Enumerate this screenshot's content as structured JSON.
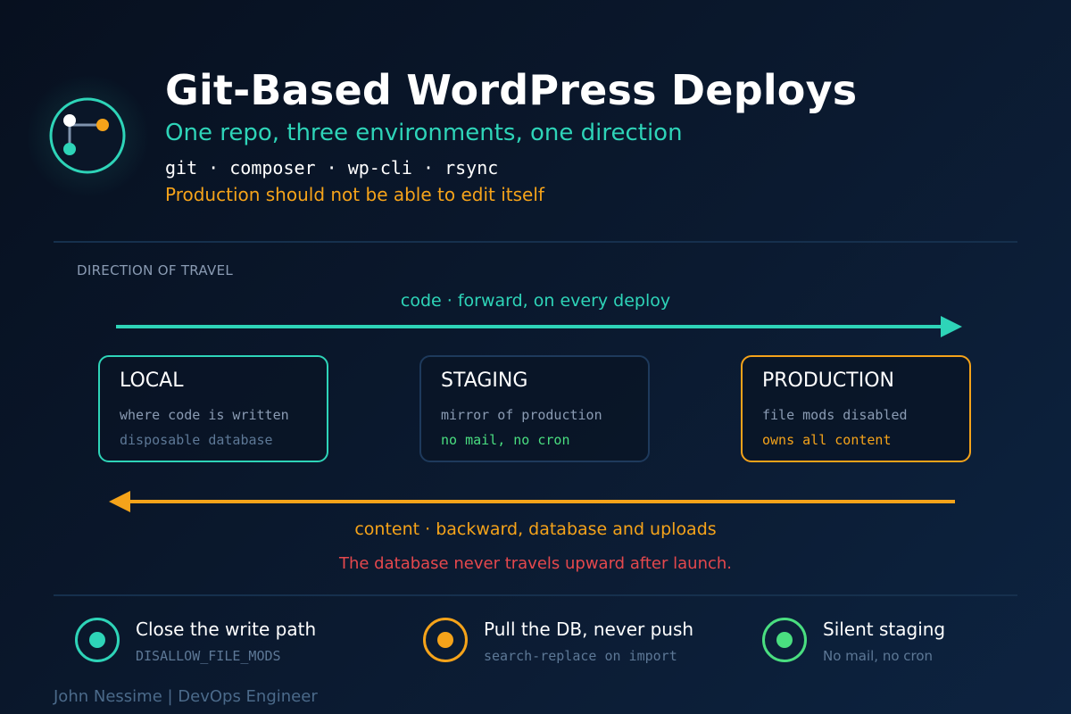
{
  "header": {
    "title": "Git-Based WordPress Deploys",
    "subtitle": "One repo, three environments, one direction",
    "tools": "git · composer · wp-cli · rsync",
    "warning": "Production should not be able to edit itself"
  },
  "flow": {
    "section_label": "DIRECTION OF TRAVEL",
    "code_caption": "code · forward, on every deploy",
    "content_caption": "content · backward, database and uploads",
    "db_warning": "The database never travels upward after launch."
  },
  "environments": [
    {
      "name": "LOCAL",
      "line1": "where code is written",
      "line2": "disposable database"
    },
    {
      "name": "STAGING",
      "line1": "mirror of production",
      "line2": "no mail, no cron"
    },
    {
      "name": "PRODUCTION",
      "line1": "file mods disabled",
      "line2": "owns all content"
    }
  ],
  "principles": [
    {
      "title": "Close the write path",
      "subtitle": "DISALLOW_FILE_MODS",
      "icon": "teal-target-icon"
    },
    {
      "title": "Pull the DB, never push",
      "subtitle": "search-replace on import",
      "icon": "orange-target-icon"
    },
    {
      "title": "Silent staging",
      "subtitle": "No mail, no cron",
      "icon": "green-target-icon"
    }
  ],
  "footer": {
    "author": "John Nessime | DevOps Engineer"
  },
  "colors": {
    "teal": "#2ed4b8",
    "orange": "#f5a31a",
    "green": "#4ade80",
    "red": "#e5484d",
    "background": "#0b1a30"
  }
}
